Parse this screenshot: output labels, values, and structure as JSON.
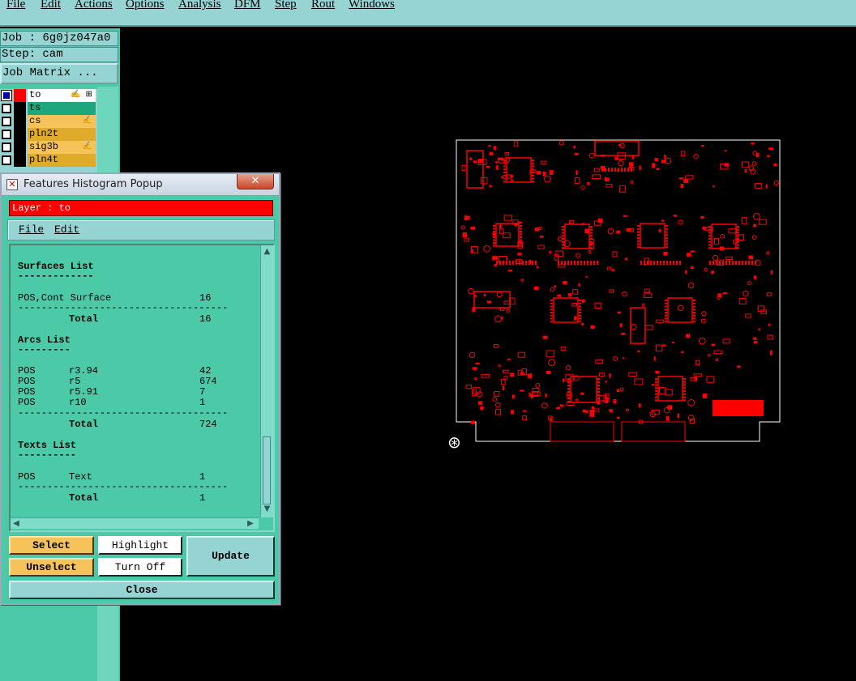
{
  "menubar": {
    "items": [
      {
        "label": "File",
        "underline": "F",
        "rest": "ile"
      },
      {
        "label": "Edit",
        "underline": "E",
        "rest": "dit"
      },
      {
        "label": "Actions",
        "underline": "A",
        "rest": "ctions"
      },
      {
        "label": "Options",
        "underline": "O",
        "rest": "ptions"
      },
      {
        "label": "Analysis",
        "underline": "A",
        "rest": "nalysis"
      },
      {
        "label": "DFM",
        "underline": "",
        "rest": "DFM"
      },
      {
        "label": "Step",
        "underline": "S",
        "rest": "tep"
      },
      {
        "label": "Rout",
        "underline": "R",
        "rest": "out"
      },
      {
        "label": "Windows",
        "underline": "W",
        "rest": "indows"
      }
    ]
  },
  "left": {
    "job": "Job : 6g0jz047a0",
    "step": "Step: cam",
    "job_matrix": "Job Matrix ..."
  },
  "layers": [
    {
      "name": "to",
      "color": "#ff0000",
      "bg": "#ffffff",
      "flag": "✍ ⊞",
      "selected": true
    },
    {
      "name": "ts",
      "color": "#000000",
      "bg": "#1ea67e",
      "flag": ""
    },
    {
      "name": "cs",
      "color": "#000000",
      "bg": "#f6c25a",
      "flag": "✍"
    },
    {
      "name": "pln2t",
      "color": "#000000",
      "bg": "#e0aa2a",
      "flag": ""
    },
    {
      "name": "sig3b",
      "color": "#000000",
      "bg": "#f6c25a",
      "flag": "✍"
    },
    {
      "name": "pln4t",
      "color": "#000000",
      "bg": "#e0aa2a",
      "flag": ""
    }
  ],
  "popup": {
    "title": "Features Histogram Popup",
    "close_glyph": "✕",
    "layer_label": "Layer :  to",
    "menu_file": "File",
    "menu_edit": "Edit",
    "buttons": {
      "select": "Select",
      "highlight": "Highlight",
      "update": "Update",
      "unselect": "Unselect",
      "turn_off": "Turn Off",
      "close": "Close"
    },
    "list": {
      "surfaces_header": "Surfaces List",
      "surfaces_underline": "-------------",
      "surfaces_rows": [
        {
          "pol": "POS,Cont Surface",
          "count": "16"
        }
      ],
      "surfaces_total_label": "Total",
      "surfaces_total": "16",
      "arcs_header": "Arcs List",
      "arcs_underline": "---------",
      "arcs_rows": [
        {
          "pol": "POS",
          "sym": "r3.94",
          "count": "42"
        },
        {
          "pol": "POS",
          "sym": "r5",
          "count": "674"
        },
        {
          "pol": "POS",
          "sym": "r5.91",
          "count": "7"
        },
        {
          "pol": "POS",
          "sym": "r10",
          "count": "1"
        }
      ],
      "arcs_total_label": "Total",
      "arcs_total": "724",
      "texts_header": "Texts List",
      "texts_underline": "----------",
      "texts_rows": [
        {
          "pol": "POS",
          "sym": "Text",
          "count": "1"
        }
      ],
      "texts_total_label": "Total",
      "texts_total": "1",
      "separator": "------------------------------------"
    }
  },
  "board": {
    "origin_icon": "⊛"
  },
  "colors": {
    "teal_bg": "#4ccaa8",
    "menu_bg": "#96d4d4",
    "layer_red": "#ff0000",
    "orange": "#f6c25a"
  }
}
